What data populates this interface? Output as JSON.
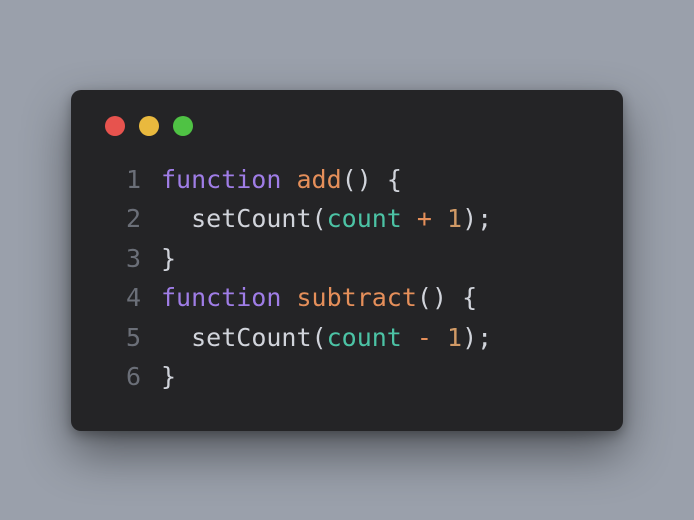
{
  "window": {
    "buttons": {
      "close": "close",
      "minimize": "minimize",
      "maximize": "maximize"
    }
  },
  "code": {
    "lines": [
      {
        "num": "1",
        "indent": "",
        "tokens": [
          {
            "t": "function",
            "c": "keyword"
          },
          {
            "t": " "
          },
          {
            "t": "add",
            "c": "funcname"
          },
          {
            "t": "()",
            "c": "punc"
          },
          {
            "t": " "
          },
          {
            "t": "{",
            "c": "punc"
          }
        ]
      },
      {
        "num": "2",
        "indent": "  ",
        "tokens": [
          {
            "t": "setCount",
            "c": "call"
          },
          {
            "t": "(",
            "c": "punc"
          },
          {
            "t": "count",
            "c": "ident"
          },
          {
            "t": " "
          },
          {
            "t": "+",
            "c": "operator"
          },
          {
            "t": " "
          },
          {
            "t": "1",
            "c": "number"
          },
          {
            "t": ");",
            "c": "punc"
          }
        ]
      },
      {
        "num": "3",
        "indent": "",
        "tokens": [
          {
            "t": "}",
            "c": "punc"
          }
        ]
      },
      {
        "num": "4",
        "indent": "",
        "tokens": [
          {
            "t": "function",
            "c": "keyword"
          },
          {
            "t": " "
          },
          {
            "t": "subtract",
            "c": "funcname"
          },
          {
            "t": "()",
            "c": "punc"
          },
          {
            "t": " "
          },
          {
            "t": "{",
            "c": "punc"
          }
        ]
      },
      {
        "num": "5",
        "indent": "  ",
        "tokens": [
          {
            "t": "setCount",
            "c": "call"
          },
          {
            "t": "(",
            "c": "punc"
          },
          {
            "t": "count",
            "c": "ident"
          },
          {
            "t": " "
          },
          {
            "t": "-",
            "c": "operator"
          },
          {
            "t": " "
          },
          {
            "t": "1",
            "c": "number"
          },
          {
            "t": ");",
            "c": "punc"
          }
        ]
      },
      {
        "num": "6",
        "indent": "",
        "tokens": [
          {
            "t": "}",
            "c": "punc"
          }
        ]
      }
    ]
  }
}
